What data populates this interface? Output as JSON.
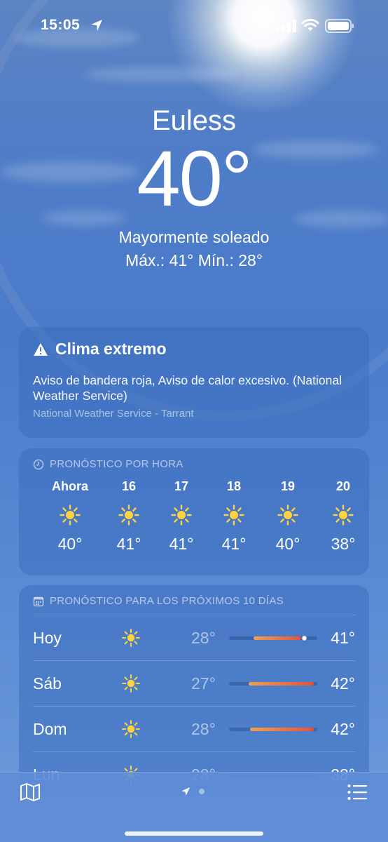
{
  "status_bar": {
    "time": "15:05"
  },
  "header": {
    "city": "Euless",
    "temperature": "40°",
    "condition": "Mayormente soleado",
    "hilo": "Máx.:  41°  Mín.: 28°"
  },
  "alert": {
    "title": "Clima extremo",
    "body": "Aviso de bandera roja, Aviso de calor excesivo. (National Weather Service)",
    "source": "National Weather Service - Tarrant"
  },
  "hourly": {
    "heading": "PRONÓSTICO POR HORA",
    "items": [
      {
        "label": "Ahora",
        "icon": "sun-icon",
        "temp": "40°"
      },
      {
        "label": "16",
        "icon": "sun-icon",
        "temp": "41°"
      },
      {
        "label": "17",
        "icon": "sun-icon",
        "temp": "41°"
      },
      {
        "label": "18",
        "icon": "sun-icon",
        "temp": "41°"
      },
      {
        "label": "19",
        "icon": "sun-icon",
        "temp": "40°"
      },
      {
        "label": "20",
        "icon": "sun-icon",
        "temp": "38°"
      }
    ]
  },
  "daily": {
    "heading": "PRONÓSTICO PARA LOS PRÓXIMOS 10 DÍAS",
    "days": [
      {
        "day": "Hoy",
        "icon": "sun-icon",
        "low": "28°",
        "high": "41°",
        "range_start": 0.28,
        "range_end": 0.82,
        "current": 0.85
      },
      {
        "day": "Sáb",
        "icon": "sun-icon",
        "low": "27°",
        "high": "42°",
        "range_start": 0.22,
        "range_end": 0.96
      },
      {
        "day": "Dom",
        "icon": "sun-icon",
        "low": "28°",
        "high": "42°",
        "range_start": 0.24,
        "range_end": 0.96
      },
      {
        "day": "Lun",
        "icon": "sun-icon",
        "low": "28°",
        "high": "38°"
      }
    ]
  },
  "colors": {
    "bar_start": "#f0a050",
    "bar_end": "#e8503a"
  },
  "bottom_bar": {
    "left_icon": "map-icon",
    "right_icon": "list-icon"
  }
}
